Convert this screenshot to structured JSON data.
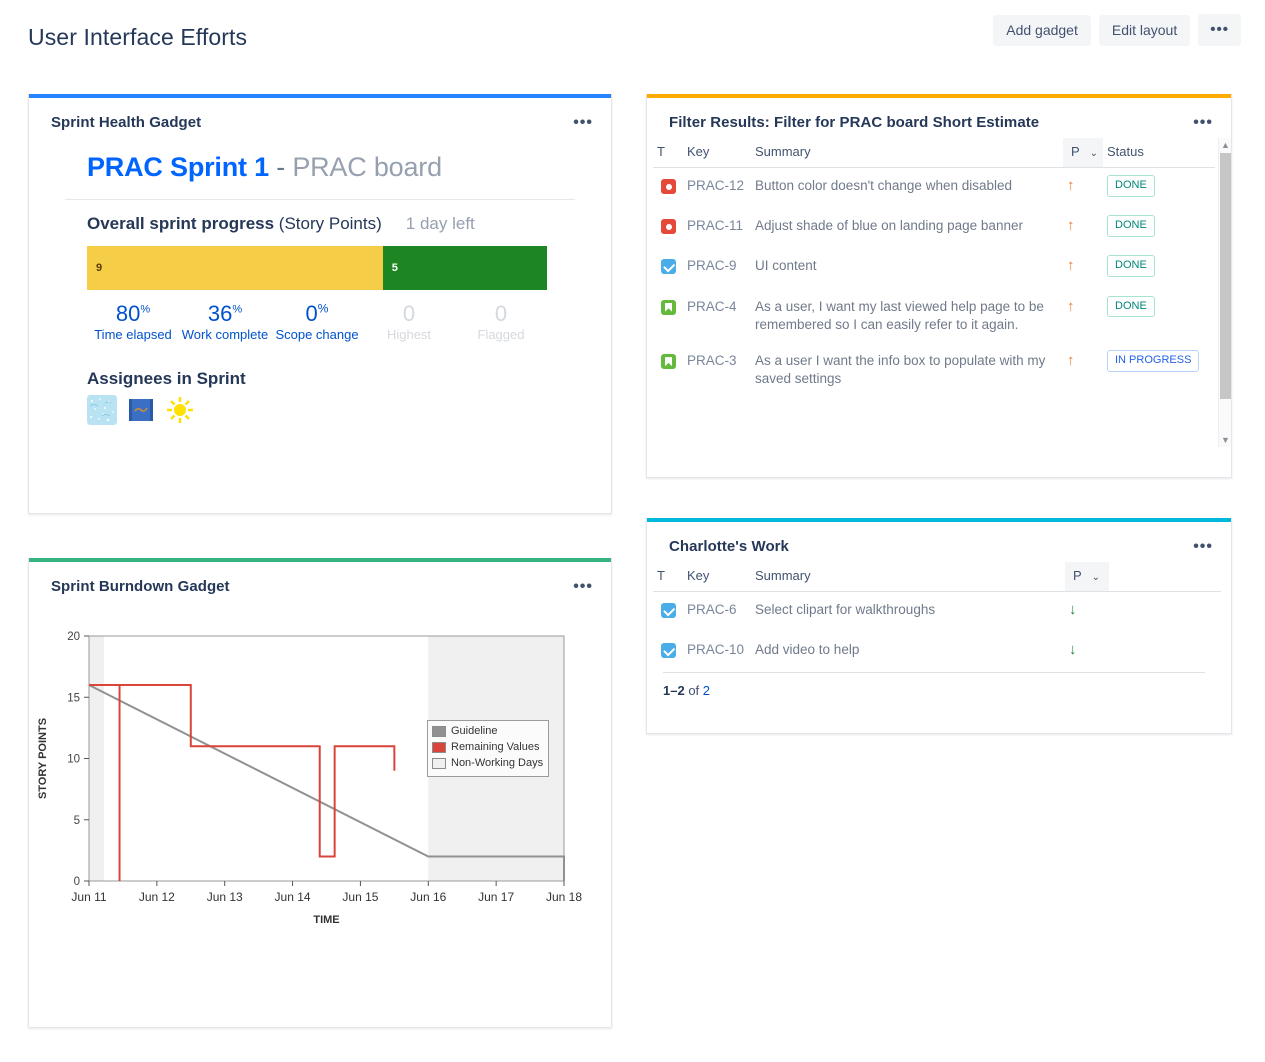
{
  "header": {
    "title": "User Interface Efforts",
    "add_gadget_label": "Add gadget",
    "edit_layout_label": "Edit layout",
    "more_label": "•••"
  },
  "sprint_health": {
    "gadget_title": "Sprint Health Gadget",
    "menu_label": "•••",
    "accent_color": "#2684ff",
    "sprint_name": "PRAC Sprint 1",
    "separator": " - ",
    "board_name": "PRAC board",
    "progress_label_bold": "Overall sprint progress",
    "progress_label_light": " (Story Points)",
    "days_left": "1 day left",
    "bar": {
      "remaining_value": "9",
      "done_value": "5",
      "remaining_color": "#f5cd47",
      "done_color": "#1e8523",
      "remaining_pct": 64.3,
      "done_pct": 35.7
    },
    "stats": [
      {
        "value": "80",
        "unit": "%",
        "label": "Time elapsed",
        "muted": false
      },
      {
        "value": "36",
        "unit": "%",
        "label": "Work complete",
        "muted": false
      },
      {
        "value": "0",
        "unit": "%",
        "label": "Scope change",
        "muted": false
      },
      {
        "value": "0",
        "unit": "",
        "label": "Highest",
        "muted": true
      },
      {
        "value": "0",
        "unit": "",
        "label": "Flagged",
        "muted": true
      }
    ],
    "assignees_title": "Assignees in Sprint",
    "avatars": [
      {
        "name": "avatar-blue-texture"
      },
      {
        "name": "avatar-blue-scroll"
      },
      {
        "name": "avatar-yellow-sun"
      }
    ]
  },
  "burndown": {
    "gadget_title": "Sprint Burndown Gadget",
    "menu_label": "•••",
    "accent_color": "#36b37e"
  },
  "chart_data": {
    "type": "line",
    "title": "Sprint Burndown Gadget",
    "xlabel": "TIME",
    "ylabel": "STORY POINTS",
    "xlim": [
      0,
      7
    ],
    "ylim": [
      0,
      20
    ],
    "yticks": [
      0,
      5,
      10,
      15,
      20
    ],
    "xticks": [
      "Jun 11",
      "Jun 12",
      "Jun 13",
      "Jun 14",
      "Jun 15",
      "Jun 16",
      "Jun 17",
      "Jun 18"
    ],
    "grid": false,
    "legend_position": "top-right",
    "legend": [
      {
        "name": "Guideline",
        "color": "#919191"
      },
      {
        "name": "Remaining Values",
        "color": "#d9453a"
      },
      {
        "name": "Non-Working Days",
        "color": "#f0f0f0"
      }
    ],
    "series": [
      {
        "name": "Guideline",
        "color": "#919191",
        "points": [
          [
            0,
            16
          ],
          [
            5,
            2
          ],
          [
            7,
            2
          ],
          [
            7,
            0
          ]
        ]
      },
      {
        "name": "Remaining Values",
        "color": "#d9453a",
        "step": true,
        "points": [
          [
            0,
            16
          ],
          [
            0.45,
            16
          ],
          [
            0.45,
            0
          ],
          [
            0.45,
            16
          ],
          [
            1.5,
            16
          ],
          [
            1.5,
            11
          ],
          [
            3.4,
            11
          ],
          [
            3.4,
            2
          ],
          [
            3.62,
            2
          ],
          [
            3.62,
            11
          ],
          [
            4.5,
            11
          ],
          [
            4.5,
            9
          ]
        ]
      }
    ],
    "non_working_bands": [
      {
        "start": 0,
        "end": 0.22
      },
      {
        "start": 5,
        "end": 7
      }
    ]
  },
  "filter_results": {
    "gadget_title": "Filter Results: Filter for PRAC board Short Estimate",
    "menu_label": "•••",
    "accent_color": "#ffab00",
    "columns": {
      "type": "T",
      "key": "Key",
      "summary": "Summary",
      "priority": "P",
      "status": "Status",
      "sort_chevron": "⌄"
    },
    "rows": [
      {
        "type": "bug",
        "key": "PRAC-12",
        "summary": "Button color doesn't change when disabled",
        "priority": "up",
        "status": "DONE",
        "status_kind": "done"
      },
      {
        "type": "bug",
        "key": "PRAC-11",
        "summary": "Adjust shade of blue on landing page banner",
        "priority": "up",
        "status": "DONE",
        "status_kind": "done"
      },
      {
        "type": "task",
        "key": "PRAC-9",
        "summary": "UI content",
        "priority": "up",
        "status": "DONE",
        "status_kind": "done"
      },
      {
        "type": "story",
        "key": "PRAC-4",
        "summary": "As a user, I want my last viewed help page to be remembered so I can easily refer to it again.",
        "priority": "up",
        "status": "DONE",
        "status_kind": "done"
      },
      {
        "type": "story",
        "key": "PRAC-3",
        "summary": "As a user I want the info box to populate with my saved settings",
        "priority": "up",
        "status": "IN PROGRESS",
        "status_kind": "progress"
      }
    ]
  },
  "charlottes_work": {
    "gadget_title": "Charlotte's Work",
    "menu_label": "•••",
    "accent_color": "#00b8d9",
    "columns": {
      "type": "T",
      "key": "Key",
      "summary": "Summary",
      "priority": "P",
      "sort_chevron": "⌄"
    },
    "rows": [
      {
        "type": "task",
        "key": "PRAC-6",
        "summary": "Select clipart for walkthroughs",
        "priority": "down"
      },
      {
        "type": "task",
        "key": "PRAC-10",
        "summary": "Add video to help",
        "priority": "down"
      }
    ],
    "pager": {
      "range": "1–2",
      "of": " of ",
      "total": "2"
    }
  }
}
